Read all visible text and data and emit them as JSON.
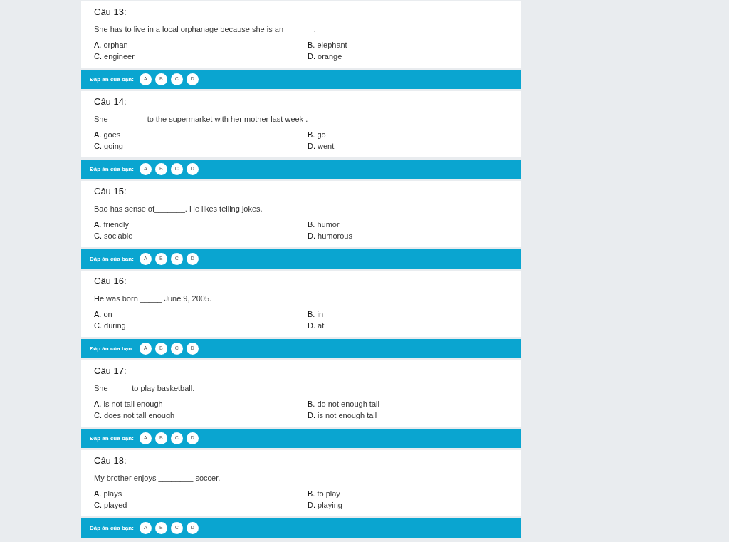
{
  "questions": [
    {
      "title": "Câu 13:",
      "text": "She has to live in a local orphanage because she is an_______.",
      "options": [
        {
          "letter": "A.",
          "text": "orphan"
        },
        {
          "letter": "B.",
          "text": "elephant"
        },
        {
          "letter": "C.",
          "text": "engineer"
        },
        {
          "letter": "D.",
          "text": "orange"
        }
      ],
      "answer_label": "Đáp án của bạn:",
      "choices": [
        {
          "label": "A",
          "selected": false
        },
        {
          "label": "B",
          "selected": false
        },
        {
          "label": "C",
          "selected": false
        },
        {
          "label": "D",
          "selected": false
        }
      ]
    },
    {
      "title": "Câu 14:",
      "text": "She ________ to the supermarket with her mother last week .",
      "options": [
        {
          "letter": "A.",
          "text": "goes"
        },
        {
          "letter": "B.",
          "text": "go"
        },
        {
          "letter": "C.",
          "text": "going"
        },
        {
          "letter": "D.",
          "text": "went"
        }
      ],
      "answer_label": "Đáp án của bạn:",
      "choices": [
        {
          "label": "A",
          "selected": false
        },
        {
          "label": "B",
          "selected": false
        },
        {
          "label": "C",
          "selected": false
        },
        {
          "label": "D",
          "selected": false
        }
      ]
    },
    {
      "title": "Câu 15:",
      "text": "Bao has sense of_______. He likes telling jokes.",
      "options": [
        {
          "letter": "A.",
          "text": "friendly"
        },
        {
          "letter": "B.",
          "text": "humor"
        },
        {
          "letter": "C.",
          "text": "sociable"
        },
        {
          "letter": "D.",
          "text": "humorous"
        }
      ],
      "answer_label": "Đáp án của bạn:",
      "choices": [
        {
          "label": "A",
          "selected": false
        },
        {
          "label": "B",
          "selected": false
        },
        {
          "label": "C",
          "selected": false
        },
        {
          "label": "D",
          "selected": false
        }
      ]
    },
    {
      "title": "Câu 16:",
      "text": "He was born _____ June 9, 2005.",
      "options": [
        {
          "letter": "A.",
          "text": "on"
        },
        {
          "letter": "B.",
          "text": "in"
        },
        {
          "letter": "C.",
          "text": "during"
        },
        {
          "letter": "D.",
          "text": "at"
        }
      ],
      "answer_label": "Đáp án của bạn:",
      "choices": [
        {
          "label": "A",
          "selected": false
        },
        {
          "label": "B",
          "selected": false
        },
        {
          "label": "C",
          "selected": false
        },
        {
          "label": "D",
          "selected": false
        }
      ]
    },
    {
      "title": "Câu 17:",
      "text": "She _____to play basketball.",
      "options": [
        {
          "letter": "A.",
          "text": "is not tall enough"
        },
        {
          "letter": "B.",
          "text": "do not enough tall"
        },
        {
          "letter": "C.",
          "text": "does not tall enough"
        },
        {
          "letter": "D.",
          "text": "is not enough tall"
        }
      ],
      "answer_label": "Đáp án của bạn:",
      "choices": [
        {
          "label": "A",
          "selected": false
        },
        {
          "label": "B",
          "selected": false
        },
        {
          "label": "C",
          "selected": false
        },
        {
          "label": "D",
          "selected": false
        }
      ]
    },
    {
      "title": "Câu 18:",
      "text": "My brother enjoys ________ soccer.",
      "options": [
        {
          "letter": "A.",
          "text": "plays"
        },
        {
          "letter": "B.",
          "text": "to play"
        },
        {
          "letter": "C.",
          "text": "played"
        },
        {
          "letter": "D.",
          "text": "playing"
        }
      ],
      "answer_label": "Đáp án của bạn:",
      "choices": [
        {
          "label": "A",
          "selected": false
        },
        {
          "label": "B",
          "selected": false
        },
        {
          "label": "C",
          "selected": false
        },
        {
          "label": "D",
          "selected": false
        }
      ]
    }
  ]
}
